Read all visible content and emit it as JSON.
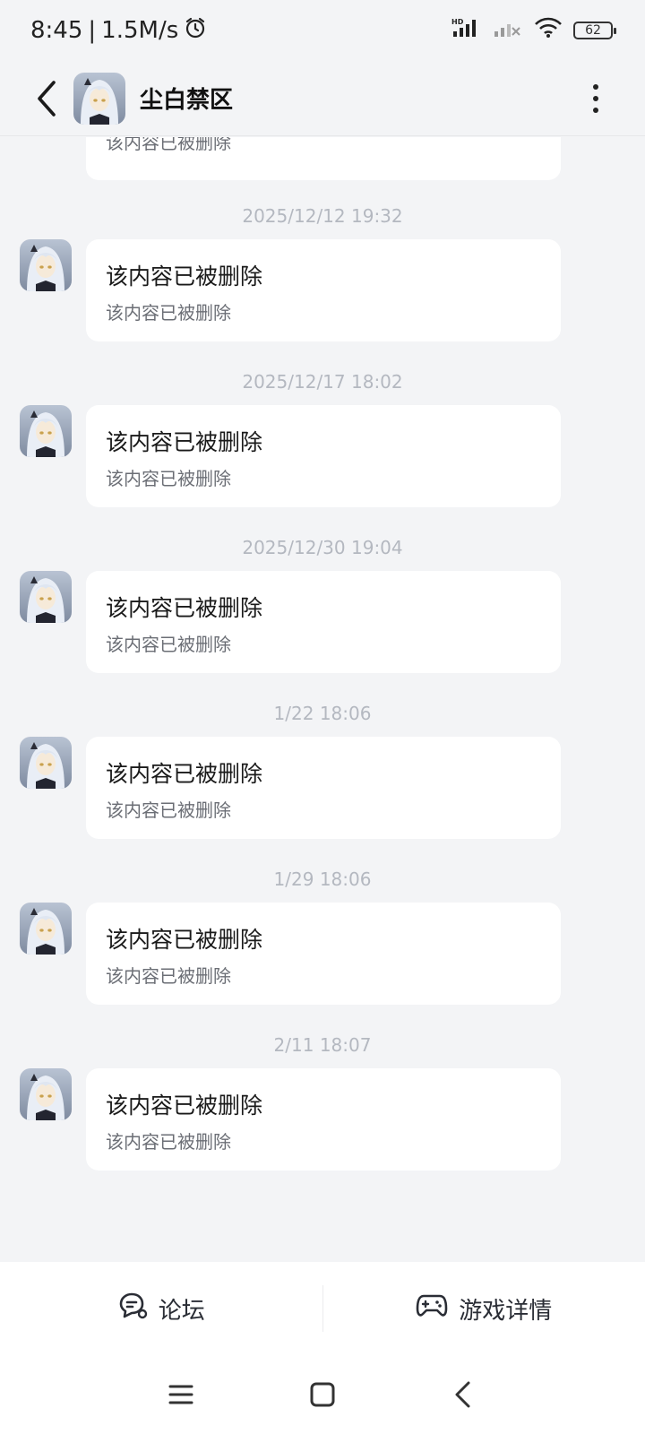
{
  "status_bar": {
    "time": "8:45",
    "separator": "|",
    "speed": "1.5M/s",
    "network_label": "HD",
    "battery": "62"
  },
  "header": {
    "title": "尘白禁区"
  },
  "messages": {
    "partial": {
      "subtitle": "该内容已被删除"
    },
    "items": [
      {
        "timestamp": "2025/12/12  19:32",
        "title": "该内容已被删除",
        "subtitle": "该内容已被删除"
      },
      {
        "timestamp": "2025/12/17  18:02",
        "title": "该内容已被删除",
        "subtitle": "该内容已被删除"
      },
      {
        "timestamp": "2025/12/30  19:04",
        "title": "该内容已被删除",
        "subtitle": "该内容已被删除"
      },
      {
        "timestamp": "1/22  18:06",
        "title": "该内容已被删除",
        "subtitle": "该内容已被删除"
      },
      {
        "timestamp": "1/29  18:06",
        "title": "该内容已被删除",
        "subtitle": "该内容已被删除"
      },
      {
        "timestamp": "2/11  18:07",
        "title": "该内容已被删除",
        "subtitle": "该内容已被删除"
      }
    ]
  },
  "bottom_tabs": {
    "forum": "论坛",
    "game_details": "游戏详情"
  },
  "icons": {
    "back": "chevron-left-icon",
    "more": "more-vertical-icon",
    "forum": "chat-bubble-icon",
    "game": "gamepad-icon",
    "nav_menu": "menu-icon",
    "nav_home": "square-home-icon",
    "nav_back": "chevron-left-icon"
  },
  "colors": {
    "background": "#f3f4f6",
    "bubble": "#ffffff",
    "timestamp": "#b4b8c0",
    "subtitle": "#6b6e75"
  }
}
